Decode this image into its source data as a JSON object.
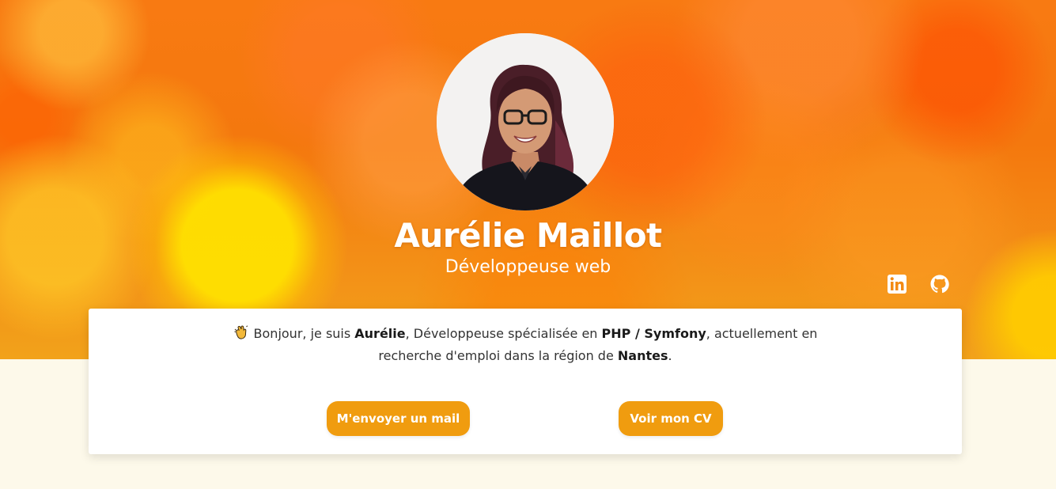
{
  "profile": {
    "name": "Aurélie Maillot",
    "role": "Développeuse web"
  },
  "social": {
    "linkedin_icon": "linkedin-icon",
    "github_icon": "github-icon"
  },
  "intro": {
    "emoji": "waving-hand-icon",
    "part1": "Bonjour, je suis ",
    "name": "Aurélie",
    "part2": ", Développeuse spécialisée en ",
    "stack": "PHP / Symfony",
    "part3": ", actuellement en recherche d'emploi dans la région de ",
    "city": "Nantes",
    "part4": "."
  },
  "actions": {
    "mail_label": "M'envoyer un mail",
    "cv_label": "Voir mon CV"
  },
  "colors": {
    "accent": "#f09c0f",
    "background": "#fdf9ea",
    "card": "#ffffff"
  }
}
